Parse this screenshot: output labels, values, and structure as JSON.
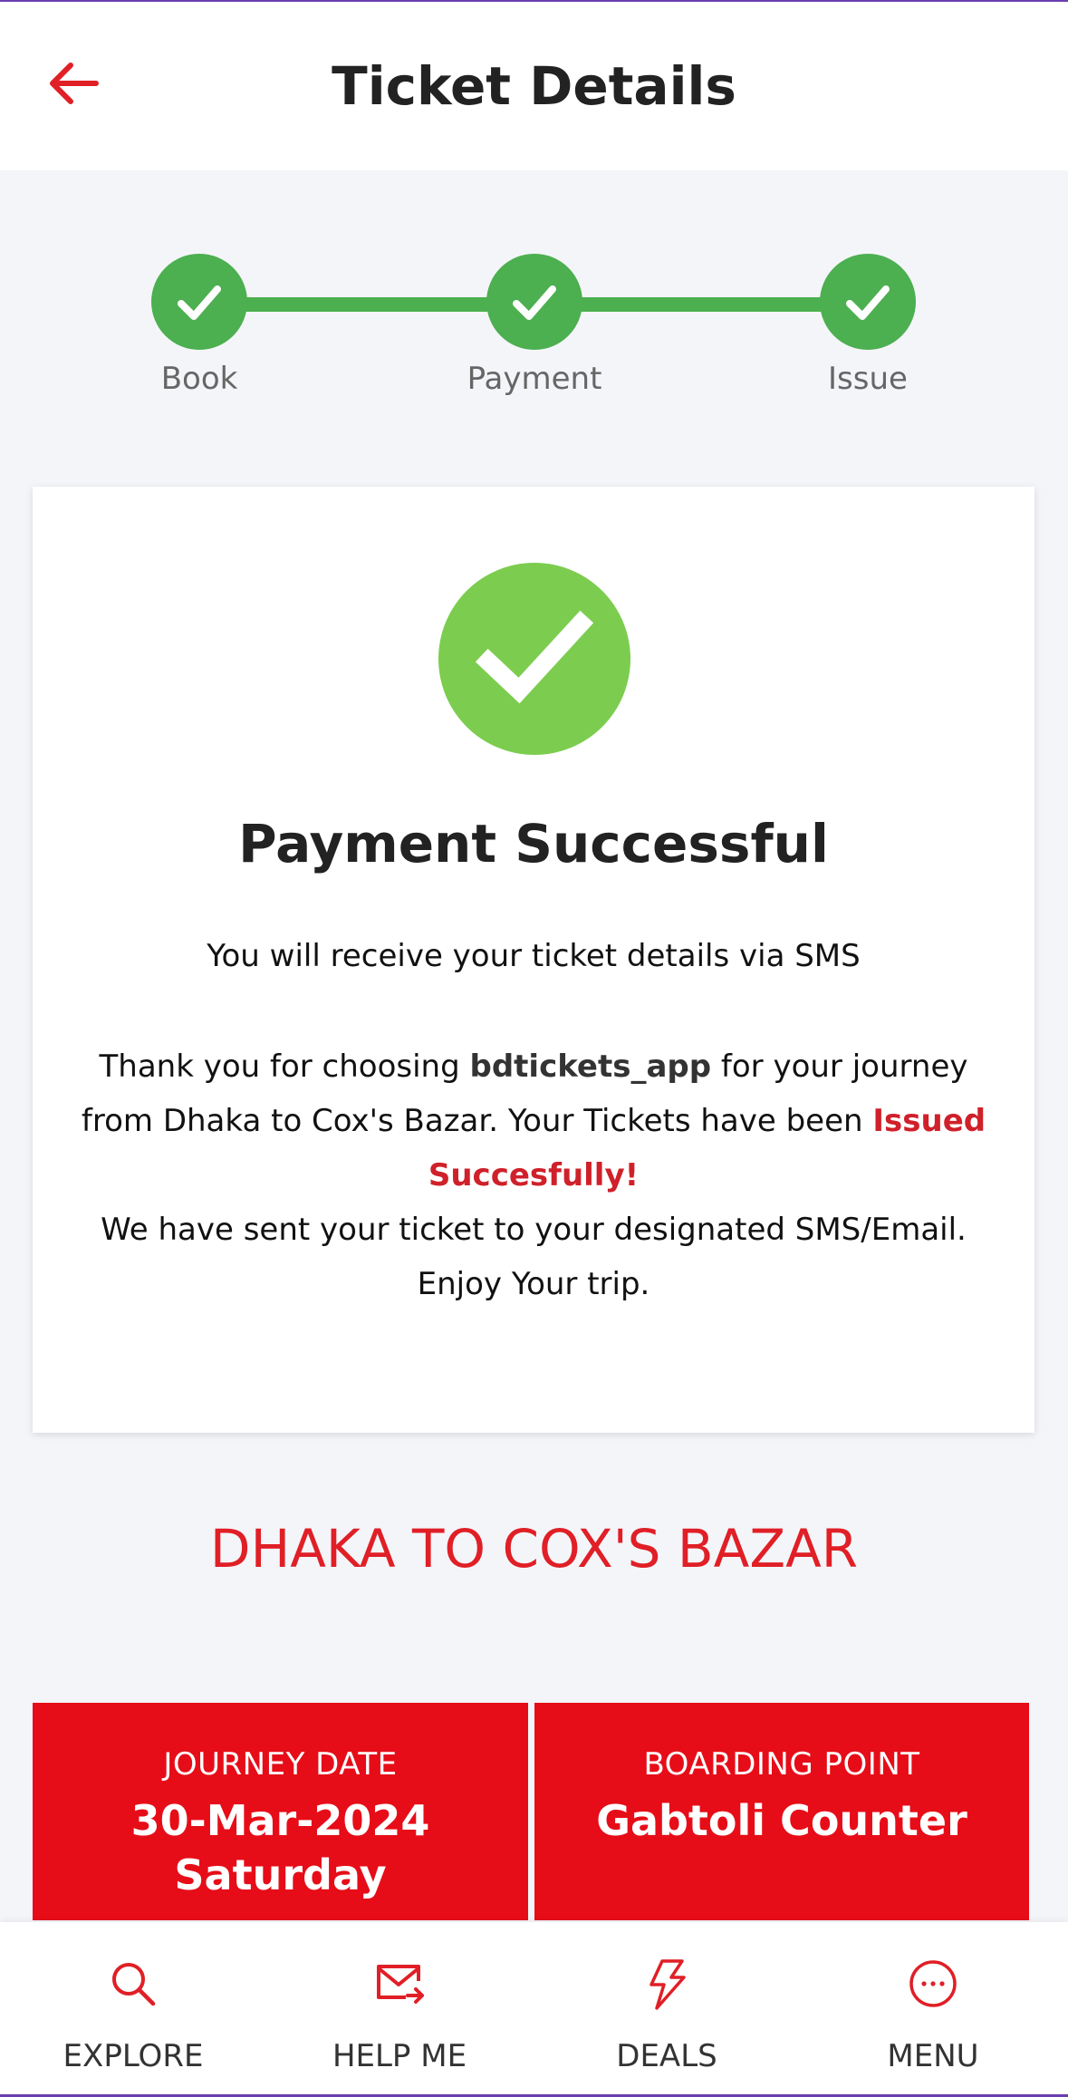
{
  "header": {
    "title": "Ticket Details",
    "back_icon": "arrow-left-icon"
  },
  "stepper": {
    "steps": [
      {
        "label": "Book",
        "done": true
      },
      {
        "label": "Payment",
        "done": true
      },
      {
        "label": "Issue",
        "done": true
      }
    ]
  },
  "success_card": {
    "icon": "check-circle-icon",
    "title": "Payment Successful",
    "sms_note": "You will receive your ticket details via SMS",
    "thank_prefix": "Thank you for choosing ",
    "app_name": "bdtickets_app",
    "thank_middle": " for your journey",
    "route_sentence": "from Dhaka to Cox's Bazar. Your Tickets have been ",
    "issued_word": "Issued",
    "success_word": "Succesfully!",
    "sent_note": "We have sent your ticket to your designated SMS/Email.",
    "enjoy": "Enjoy Your trip."
  },
  "route": "DHAKA TO COX'S BAZAR",
  "journey": {
    "date_label": "JOURNEY DATE",
    "date": "30-Mar-2024",
    "day": "Saturday",
    "boarding_label": "BOARDING POINT",
    "boarding_point": "Gabtoli Counter"
  },
  "bottom_nav": [
    {
      "label": "EXPLORE",
      "icon": "search-icon"
    },
    {
      "label": "HELP ME",
      "icon": "mail-forward-icon"
    },
    {
      "label": "DEALS",
      "icon": "lightning-icon"
    },
    {
      "label": "MENU",
      "icon": "more-circle-icon"
    }
  ],
  "colors": {
    "accent_red": "#e60d18",
    "success_green": "#4caf50",
    "check_green": "#7ccd4f"
  }
}
